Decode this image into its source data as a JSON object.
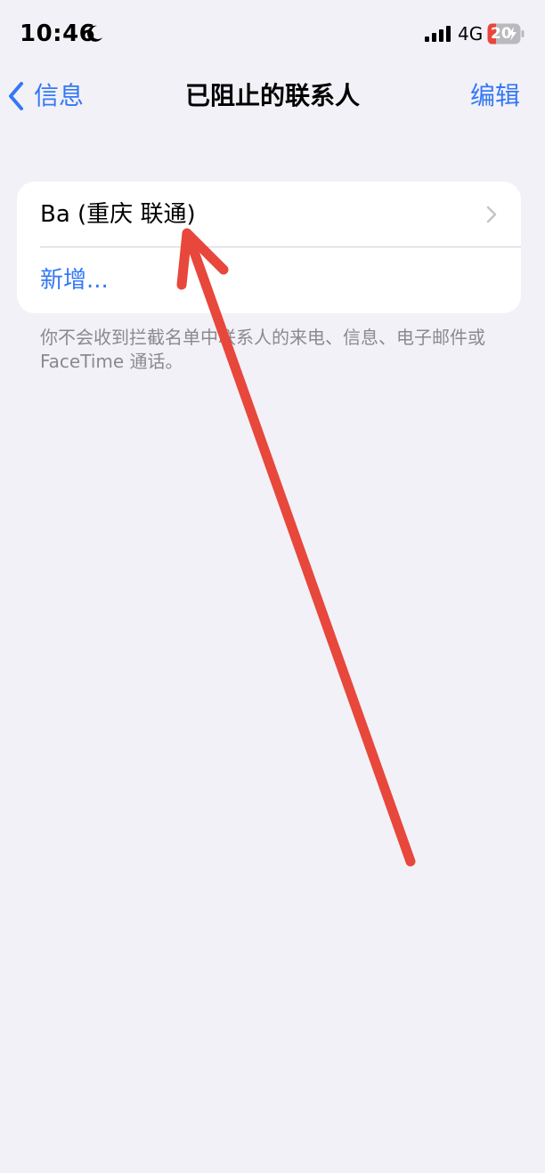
{
  "status_bar": {
    "time": "10:46",
    "network": "4G",
    "battery_level": "20",
    "moon_icon": "moon-icon",
    "signal_icon": "cellular-signal-icon",
    "battery_icon": "battery-charging-icon"
  },
  "nav": {
    "back_label": "信息",
    "title": "已阻止的联系人",
    "edit_label": "编辑",
    "back_icon": "chevron-left-icon"
  },
  "blocked_list": {
    "items": [
      {
        "label": "Ba (重庆  联通)"
      }
    ],
    "add_label": "新增...",
    "chevron_icon": "chevron-right-icon"
  },
  "footer": {
    "note": "你不会收到拦截名单中联系人的来电、信息、电子邮件或 FaceTime 通话。"
  },
  "colors": {
    "accent": "#3478F6",
    "background": "#F2F1F7",
    "card": "#FFFFFF",
    "secondary_text": "#8A8A8E",
    "annotation": "#E8473C",
    "battery_low": "#E8473C"
  }
}
